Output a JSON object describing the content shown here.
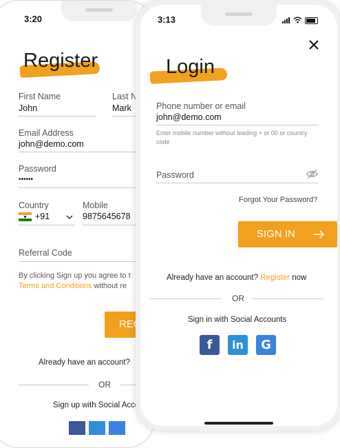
{
  "register": {
    "status_time": "3:20",
    "title": "Register",
    "first_name_label": "First Name",
    "first_name_value": "John",
    "last_name_label": "Last N",
    "last_name_value": "Mark",
    "email_label": "Email Address",
    "email_value": "john@demo.com",
    "password_label": "Password",
    "password_value": "••••••",
    "country_label": "Country",
    "country_code": "+91",
    "mobile_label": "Mobile",
    "mobile_value": "9875645678",
    "referral_label": "Referral Code",
    "terms_text": "By clicking Sign up you agree to t",
    "terms_link": "Terms and Conditions",
    "terms_suffix": "without re",
    "register_button": "REG",
    "have_account": "Already have an account?",
    "or": "OR",
    "social_title": "Sign up with Social Acco"
  },
  "login": {
    "status_time": "3:13",
    "title": "Login",
    "phone_label": "Phone number or email",
    "phone_value": "john@demo.com",
    "hint": "Enter mobile number without leading + or 00 or country code",
    "password_label": "Password",
    "forgot": "Forgot Your Password?",
    "signin_button": "SIGN IN",
    "have_account_prefix": "Already have an account?",
    "register_link": "Register",
    "have_account_suffix": "now",
    "or": "OR",
    "social_title": "Sign in with Social Accounts",
    "social": [
      {
        "name": "facebook-icon",
        "glyph": "f",
        "color": "#3b5998"
      },
      {
        "name": "linkedin-icon",
        "glyph": "in",
        "color": "#2f8fd8"
      },
      {
        "name": "google-icon",
        "glyph": "G",
        "color": "#3b82e0"
      }
    ]
  },
  "colors": {
    "accent": "#f2a01f"
  }
}
